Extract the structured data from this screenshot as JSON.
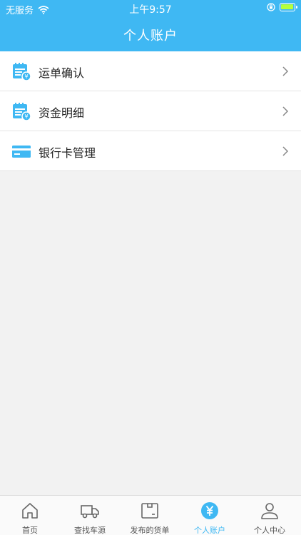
{
  "status_bar": {
    "carrier": "无服务",
    "time": "上午9:57"
  },
  "header": {
    "title": "个人账户"
  },
  "menu": {
    "items": [
      {
        "label": "运单确认",
        "icon": "waybill-calendar-icon"
      },
      {
        "label": "资金明细",
        "icon": "funds-calendar-icon"
      },
      {
        "label": "银行卡管理",
        "icon": "bank-card-icon"
      }
    ]
  },
  "tabbar": {
    "tabs": [
      {
        "label": "首页",
        "icon": "home-icon"
      },
      {
        "label": "查找车源",
        "icon": "truck-icon"
      },
      {
        "label": "发布的货单",
        "icon": "package-icon"
      },
      {
        "label": "个人账户",
        "icon": "yuan-icon",
        "active": true
      },
      {
        "label": "个人中心",
        "icon": "user-icon"
      }
    ]
  },
  "colors": {
    "accent": "#3fb8f3",
    "background": "#f2f2f2"
  }
}
